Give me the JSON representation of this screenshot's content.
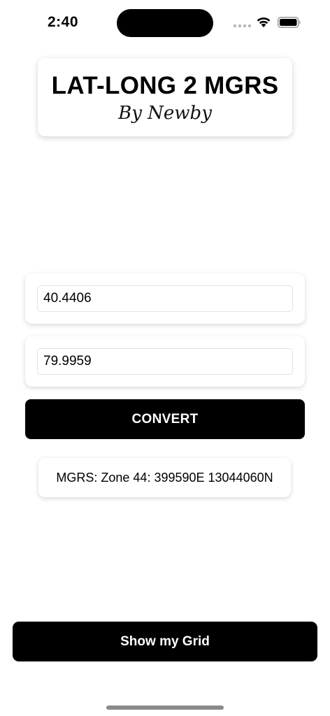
{
  "status_bar": {
    "time": "2:40",
    "icons": [
      "signal-dots-icon",
      "wifi-icon",
      "battery-icon"
    ]
  },
  "header": {
    "title": "LAT-LONG 2 MGRS",
    "subtitle": "By Newby"
  },
  "form": {
    "latitude_value": "40.4406",
    "longitude_value": "79.9959",
    "convert_label": "CONVERT"
  },
  "result": {
    "text": "MGRS: Zone 44: 399590E 13044060N"
  },
  "footer": {
    "grid_button_label": "Show my Grid"
  },
  "colors": {
    "background": "#ffffff",
    "button_background": "#000000",
    "button_text": "#ffffff"
  }
}
